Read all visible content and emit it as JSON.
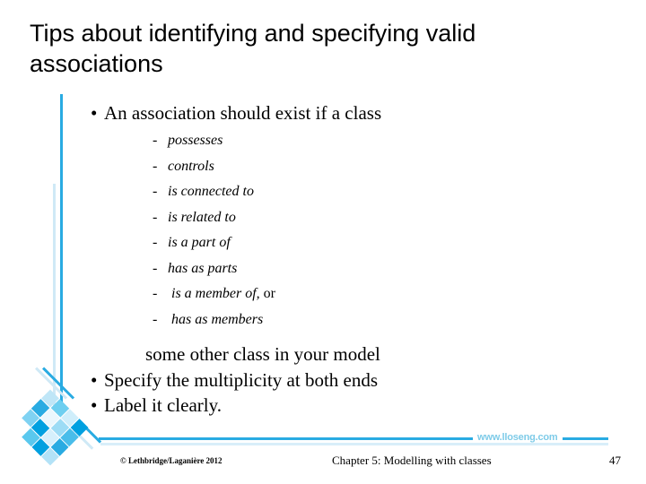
{
  "slide": {
    "title_line1": "Tips about identifying and specifying valid",
    "title_line2": "associations",
    "bullets": {
      "lead": "An association should exist if a class",
      "sub_items": [
        "possesses",
        "controls",
        "is connected to",
        "is related to",
        "is a part of",
        "has as parts",
        " is a member of,",
        " has as members"
      ],
      "sub_item_suffix": " or",
      "closing": "some other class in your model",
      "tail": [
        "Specify the multiplicity at both ends",
        "Label it clearly."
      ]
    }
  },
  "footer": {
    "url": "www.lloseng.com",
    "copyright": "© Lethbridge/Laganière 2012",
    "chapter": "Chapter 5: Modelling with classes",
    "page": "47"
  },
  "colors": {
    "accent_bright": "#29abe2",
    "accent_pale": "#cfe9f6",
    "url_text": "#7ecbe8",
    "background": "#ffffff",
    "text": "#000000"
  },
  "mosaic": {
    "tiles": [
      "#bfe6f7",
      "#6ecff0",
      "#cfeefb",
      "#00a0e0",
      "#29abe2",
      "#eaf7fd",
      "#9ddcf5",
      "#49bdea",
      "#7fd2f2",
      "#00a0e0",
      "#d6f0fc",
      "#29abe2",
      "#ffffff",
      "#5ac8ee",
      "#00a0e0",
      "#b3e2f7"
    ]
  }
}
